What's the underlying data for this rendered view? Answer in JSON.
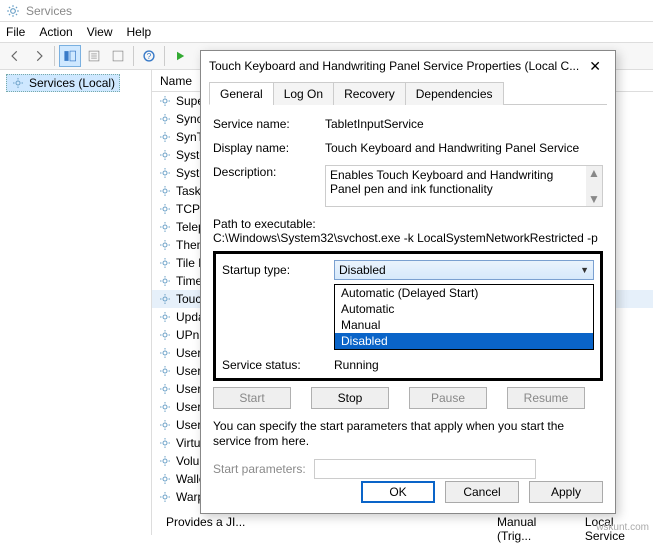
{
  "window": {
    "title": "Services"
  },
  "menus": {
    "file": "File",
    "action": "Action",
    "view": "View",
    "help": "Help"
  },
  "left": {
    "node": "Services (Local)"
  },
  "columns": {
    "name": "Name"
  },
  "services": [
    "Superfetc",
    "Sync Hos",
    "SynTPEnh",
    "System Ev",
    "System Ev",
    "Task Sche",
    "TCP/IP Ne",
    "Telephony",
    "Themes",
    "Tile Data",
    "Time Brok",
    "Touch Ke",
    "Update O",
    "UPnP De",
    "User Data",
    "User Data",
    "User Expe",
    "User Man",
    "User Profi",
    "Virtual Dis",
    "Volume S",
    "WalletSer",
    "WarpJITSvc"
  ],
  "dialog": {
    "title": "Touch Keyboard and Handwriting Panel Service Properties (Local C...",
    "close": "✕",
    "tabs": {
      "general": "General",
      "logon": "Log On",
      "recovery": "Recovery",
      "deps": "Dependencies"
    },
    "labels": {
      "service_name": "Service name:",
      "display_name": "Display name:",
      "description": "Description:",
      "path": "Path to executable:",
      "startup": "Startup type:",
      "status": "Service status:",
      "start": "Start",
      "stop": "Stop",
      "pause": "Pause",
      "resume": "Resume",
      "hint": "You can specify the start parameters that apply when you start the service from here.",
      "params": "Start parameters:",
      "ok": "OK",
      "cancel": "Cancel",
      "apply": "Apply"
    },
    "values": {
      "service_name": "TabletInputService",
      "display_name": "Touch Keyboard and Handwriting Panel Service",
      "description": "Enables Touch Keyboard and Handwriting Panel pen and ink functionality",
      "path": "C:\\Windows\\System32\\svchost.exe -k LocalSystemNetworkRestricted -p",
      "startup_selected": "Disabled",
      "status": "Running"
    },
    "options": [
      "Automatic (Delayed Start)",
      "Automatic",
      "Manual",
      "Disabled"
    ]
  },
  "bottomrow": {
    "c1": "Provides a JI...",
    "c2": "Manual (Trig...",
    "c3": "Local Service"
  },
  "watermark": "wskunt.com"
}
